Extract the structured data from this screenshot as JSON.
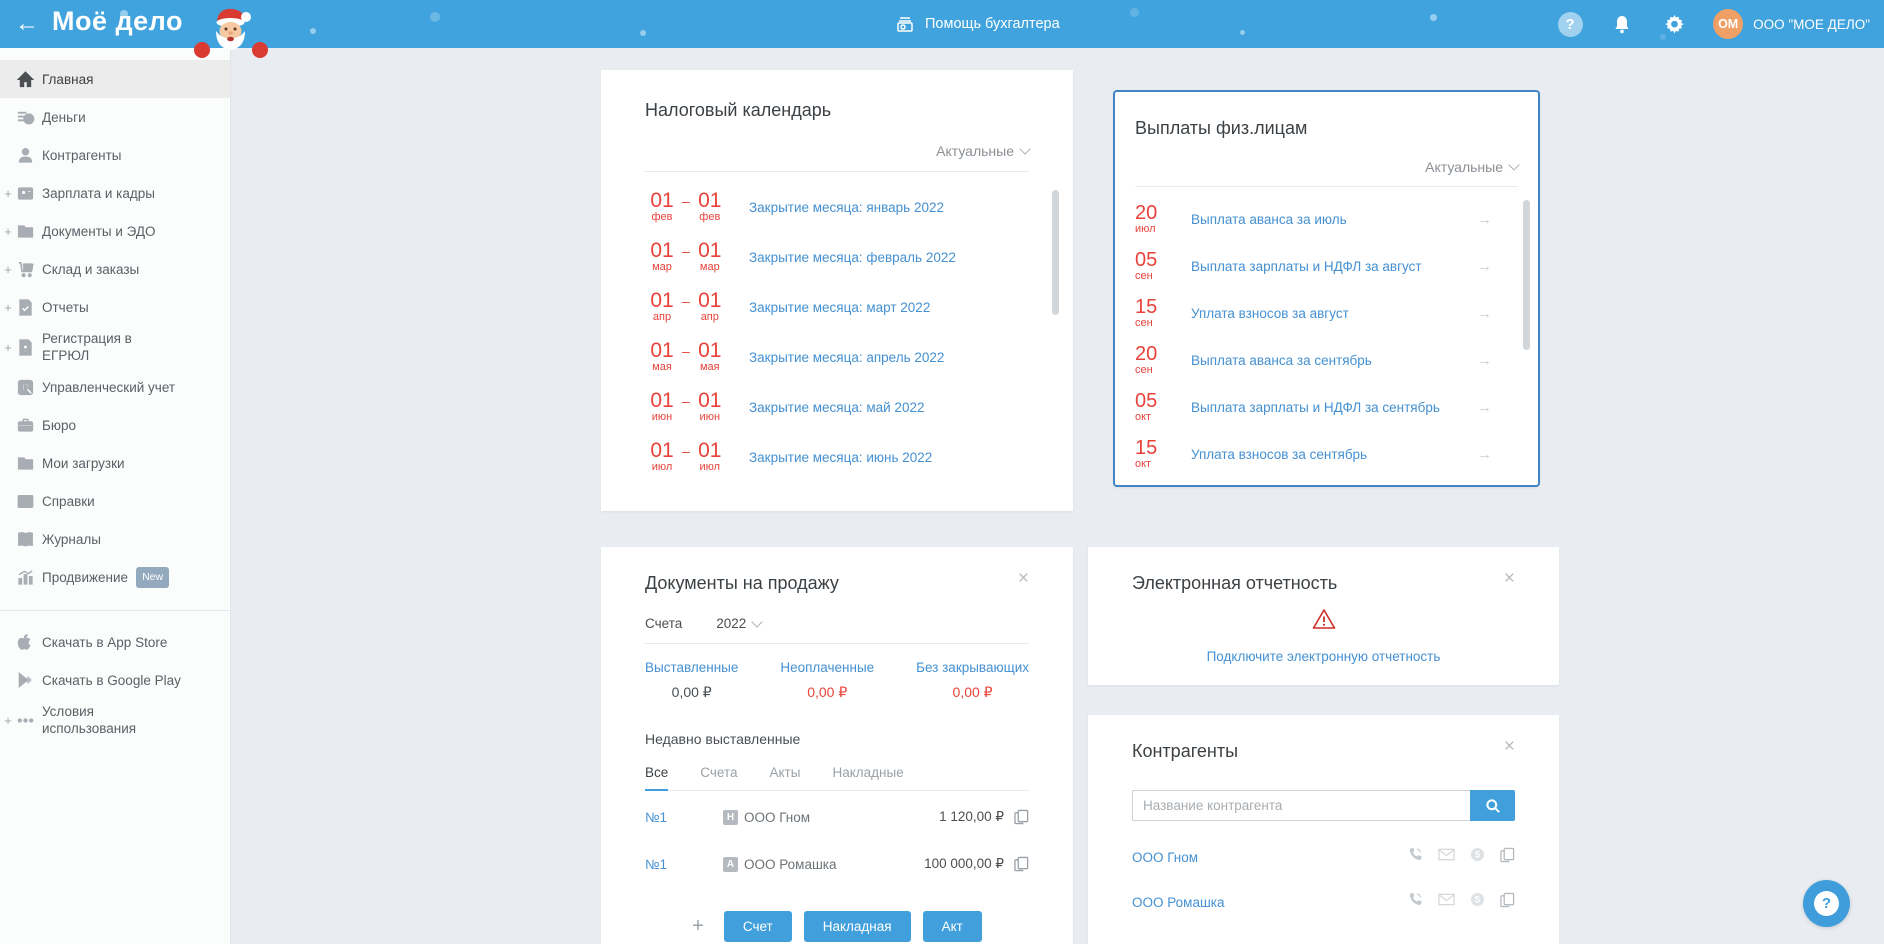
{
  "colors": {
    "header_blue": "#40a3dd",
    "accent_blue": "#41a0dc",
    "link_blue": "#4490d2",
    "alert_red": "#e8423a",
    "highlight_border": "#4285c4",
    "main_background": "#e9edf1"
  },
  "header": {
    "logo": "Моё дело",
    "helper_label": "Помощь бухгалтера",
    "account_initials": "ОМ",
    "account_name": "ООО \"МОЕ ДЕЛО\""
  },
  "sidebar": {
    "items": [
      {
        "label": "Главная",
        "active": true
      },
      {
        "label": "Деньги"
      },
      {
        "label": "Контрагенты"
      },
      {
        "label": "Зарплата и кадры",
        "expandable": true
      },
      {
        "label": "Документы и ЭДО",
        "expandable": true
      },
      {
        "label": "Склад и заказы",
        "expandable": true
      },
      {
        "label": "Отчеты",
        "expandable": true
      },
      {
        "label": "Регистрация в ЕГРЮЛ",
        "expandable": true
      },
      {
        "label": "Управленческий учет"
      },
      {
        "label": "Бюро"
      },
      {
        "label": "Мои загрузки"
      },
      {
        "label": "Справки"
      },
      {
        "label": "Журналы"
      },
      {
        "label": "Продвижение",
        "badge": "New"
      }
    ],
    "footer_items": [
      {
        "label": "Скачать в App Store"
      },
      {
        "label": "Скачать в Google Play"
      },
      {
        "label": "Условия использования",
        "expandable": true
      }
    ]
  },
  "tax_calendar": {
    "title": "Налоговый календарь",
    "filter": "Актуальные",
    "events": [
      {
        "day_from": "01",
        "month_from": "фев",
        "day_to": "01",
        "month_to": "фев",
        "label": "Закрытие месяца: январь 2022"
      },
      {
        "day_from": "01",
        "month_from": "мар",
        "day_to": "01",
        "month_to": "мар",
        "label": "Закрытие месяца: февраль 2022"
      },
      {
        "day_from": "01",
        "month_from": "апр",
        "day_to": "01",
        "month_to": "апр",
        "label": "Закрытие месяца: март 2022"
      },
      {
        "day_from": "01",
        "month_from": "мая",
        "day_to": "01",
        "month_to": "мая",
        "label": "Закрытие месяца: апрель 2022"
      },
      {
        "day_from": "01",
        "month_from": "июн",
        "day_to": "01",
        "month_to": "июн",
        "label": "Закрытие месяца: май 2022"
      },
      {
        "day_from": "01",
        "month_from": "июл",
        "day_to": "01",
        "month_to": "июл",
        "label": "Закрытие месяца: июнь 2022"
      }
    ]
  },
  "payouts": {
    "title": "Выплаты физ.лицам",
    "filter": "Актуальные",
    "events": [
      {
        "day": "20",
        "month": "июл",
        "label": "Выплата аванса за июль"
      },
      {
        "day": "05",
        "month": "сен",
        "label": "Выплата зарплаты и НДФЛ за август"
      },
      {
        "day": "15",
        "month": "сен",
        "label": "Уплата взносов за август"
      },
      {
        "day": "20",
        "month": "сен",
        "label": "Выплата аванса за сентябрь"
      },
      {
        "day": "05",
        "month": "окт",
        "label": "Выплата зарплаты и НДФЛ за сентябрь"
      },
      {
        "day": "15",
        "month": "окт",
        "label": "Уплата взносов за сентябрь"
      }
    ]
  },
  "sales_documents": {
    "title": "Документы на продажу",
    "doc_type_label": "Счета",
    "year": "2022",
    "stats": [
      {
        "label": "Выставленные",
        "value": "0,00 ₽",
        "red": false
      },
      {
        "label": "Неоплаченные",
        "value": "0,00 ₽",
        "red": true
      },
      {
        "label": "Без закрывающих",
        "value": "0,00 ₽",
        "red": true
      }
    ],
    "recent_title": "Недавно выставленные",
    "tabs": [
      {
        "label": "Все",
        "active": true
      },
      {
        "label": "Счета"
      },
      {
        "label": "Акты"
      },
      {
        "label": "Накладные"
      }
    ],
    "rows": [
      {
        "number": "№1",
        "type_badge": "Н",
        "company": "ООО Гном",
        "amount": "1 120,00 ₽"
      },
      {
        "number": "№1",
        "type_badge": "А",
        "company": "ООО Ромашка",
        "amount": "100 000,00 ₽"
      }
    ],
    "create_buttons": [
      {
        "label": "Счет"
      },
      {
        "label": "Накладная"
      },
      {
        "label": "Акт"
      }
    ]
  },
  "e_reporting": {
    "title": "Электронная отчетность",
    "connect_link": "Подключите электронную отчетность"
  },
  "counterparties": {
    "title": "Контрагенты",
    "search_placeholder": "Название контрагента",
    "rows": [
      {
        "name": "ООО Гном"
      },
      {
        "name": "ООО Ромашка"
      }
    ]
  }
}
